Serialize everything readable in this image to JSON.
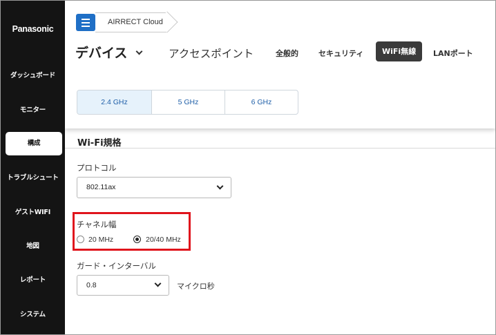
{
  "sidebar": {
    "brand": "Panasonic",
    "items": [
      {
        "label": "ダッシュボード"
      },
      {
        "label": "モニター"
      },
      {
        "label": "構成"
      },
      {
        "label": "トラブルシュート"
      },
      {
        "label": "ゲストWIFI"
      },
      {
        "label": "地図"
      },
      {
        "label": "レポート"
      },
      {
        "label": "システム"
      }
    ],
    "active_item": "構成"
  },
  "header": {
    "breadcrumb": "AIRRECT Cloud",
    "device_title": "デバイス",
    "access_point_title": "アクセスポイント",
    "tabs": [
      {
        "label": "全般的"
      },
      {
        "label": "セキュリティ"
      },
      {
        "label": "WiFi無線"
      },
      {
        "label": "LANポート"
      }
    ],
    "active_tab": "WiFi無線"
  },
  "bands": {
    "items": [
      {
        "label": "2.4 GHz"
      },
      {
        "label": "5 GHz"
      },
      {
        "label": "6 GHz"
      }
    ],
    "active": "2.4 GHz"
  },
  "wifi_standard": {
    "section_title": "Wi-Fi規格",
    "protocol": {
      "label": "プロトコル",
      "value": "802.11ax"
    },
    "channel_width": {
      "label": "チャネル幅",
      "options": [
        {
          "label": "20 MHz",
          "checked": false
        },
        {
          "label": "20/40 MHz",
          "checked": true
        }
      ]
    },
    "guard_interval": {
      "label": "ガード・インターバル",
      "value": "0.8",
      "unit": "マイクロ秒"
    }
  },
  "colors": {
    "sidebar_bg": "#141414",
    "accent_blue": "#1f6fc6",
    "highlight_red": "#e0141c",
    "active_tab_bg": "#3a3a3a"
  },
  "icons": {
    "menu": "hamburger-menu-icon",
    "device_dropdown": "chevron-down-icon",
    "select_dropdown": "chevron-down-icon"
  }
}
